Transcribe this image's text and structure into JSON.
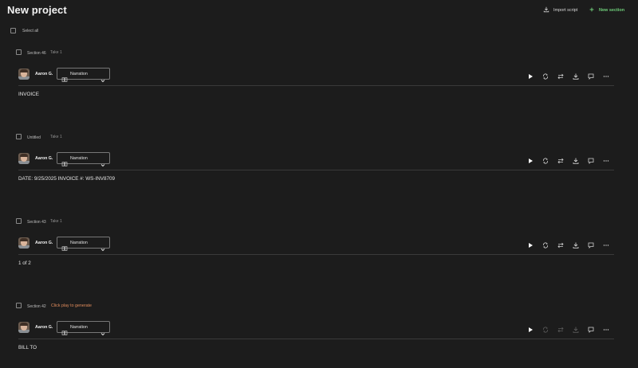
{
  "header": {
    "title": "New project",
    "import_label": "Import script",
    "new_section_label": "New section"
  },
  "select_all_label": "Select all",
  "sections": [
    {
      "name": "Section 46",
      "take": "Take 1",
      "status": "",
      "voice": "Aaron G.",
      "style": "Narration",
      "text": "INVOICE"
    },
    {
      "name": "Untitled",
      "take": "Take 1",
      "status": "",
      "voice": "Aaron G.",
      "style": "Narration",
      "text": "DATE: 9/25/2025 INVOICE #: WS-INV8709"
    },
    {
      "name": "Section 43",
      "take": "Take 1",
      "status": "",
      "voice": "Aaron G.",
      "style": "Narration",
      "text": "1 of 2"
    },
    {
      "name": "Section 42",
      "take": "",
      "status": "Click play to generate",
      "voice": "Aaron G.",
      "style": "Narration",
      "text": "BILL TO"
    }
  ],
  "colors": {
    "background": "#1c1c1c",
    "accent_green": "#6fcf7a",
    "generate_orange": "#e08c5c"
  },
  "icons": {
    "import": "download-icon",
    "new_section": "plus-icon",
    "style": "book-icon",
    "dropdown": "chevron-down-icon",
    "actions": [
      "play-icon",
      "regenerate-icon",
      "swap-icon",
      "download-icon",
      "comment-icon",
      "more-icon"
    ]
  }
}
